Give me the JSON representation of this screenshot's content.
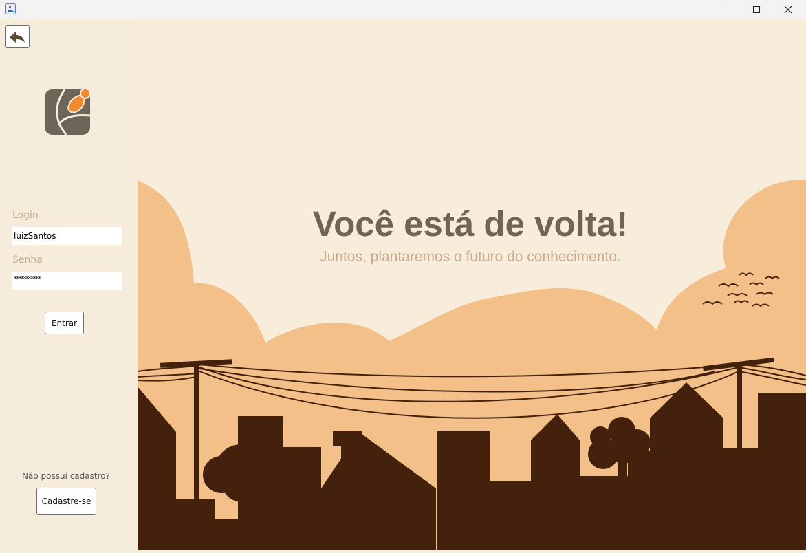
{
  "window": {
    "icon": "java-cup-icon",
    "controls": [
      "minimize-icon",
      "maximize-icon",
      "close-icon"
    ]
  },
  "sidebar": {
    "back_icon": "back-arrow-icon",
    "logo_icon": "leaf-person-logo-icon",
    "login_label": "Login",
    "login_value": "luizSantos",
    "password_label": "Senha",
    "password_value": "***********",
    "submit_label": "Entrar",
    "no_account_text": "Não possuí cadastro?",
    "register_label": "Cadastre-se"
  },
  "hero": {
    "title": "Você está de volta!",
    "subtitle": "Juntos, plantaremos o futuro do conhecimento."
  },
  "colors": {
    "background": "#f8ecdb",
    "clouds": "#f4c08a",
    "silhouette": "#43210d",
    "title_text": "#726453",
    "muted_text": "#c8ab8c",
    "logo_gray": "#6e6458",
    "logo_orange": "#f28a2e"
  }
}
